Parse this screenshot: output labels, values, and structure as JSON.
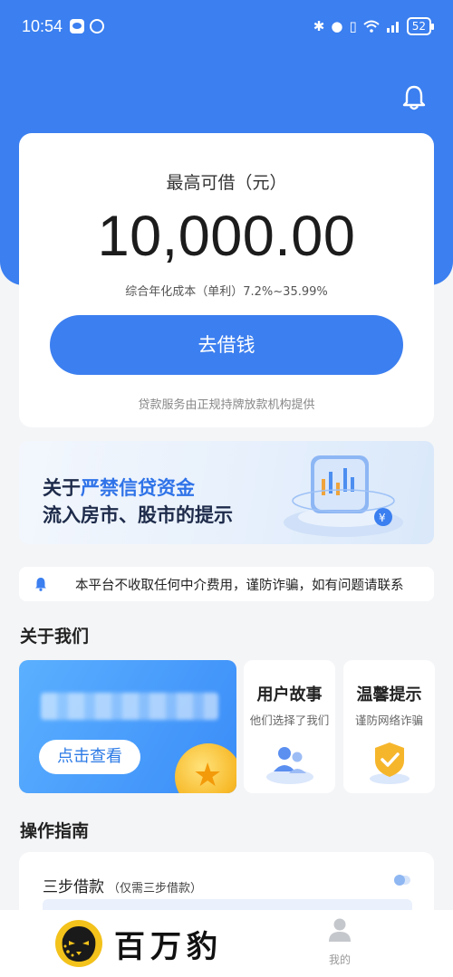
{
  "status_bar": {
    "time": "10:54",
    "battery": "52",
    "icons": [
      "wechat-icon",
      "alarm-icon",
      "bluetooth-icon",
      "location-icon",
      "vibrate-icon",
      "wifi-icon",
      "signal-icon",
      "battery-icon"
    ]
  },
  "header": {
    "icon": "bell-icon"
  },
  "loan_card": {
    "label": "最高可借（元）",
    "amount": "10,000.00",
    "rate": "综合年化成本（单利）7.2%~35.99%",
    "button": "去借钱",
    "note": "贷款服务由正规持牌放款机构提供"
  },
  "banner": {
    "line1_prefix": "关于",
    "line1_highlight": "严禁信贷资金",
    "line2": "流入房市、股市的提示"
  },
  "notice": {
    "icon": "bell-icon",
    "text": "本平台不收取任何中介费用，谨防诈骗，如有问题请联系"
  },
  "about": {
    "title": "关于我们",
    "main_button": "点击查看",
    "cards": [
      {
        "title": "用户故事",
        "subtitle": "他们选择了我们"
      },
      {
        "title": "温馨提示",
        "subtitle": "谨防网络诈骗"
      }
    ]
  },
  "guide": {
    "title": "操作指南",
    "item_title": "三步借款",
    "item_subtitle": "（仅需三步借款）"
  },
  "bottom_nav": {
    "brand": "百万豹",
    "me_label": "我的"
  },
  "colors": {
    "primary": "#3b7ff0",
    "background": "#f4f5f7"
  }
}
